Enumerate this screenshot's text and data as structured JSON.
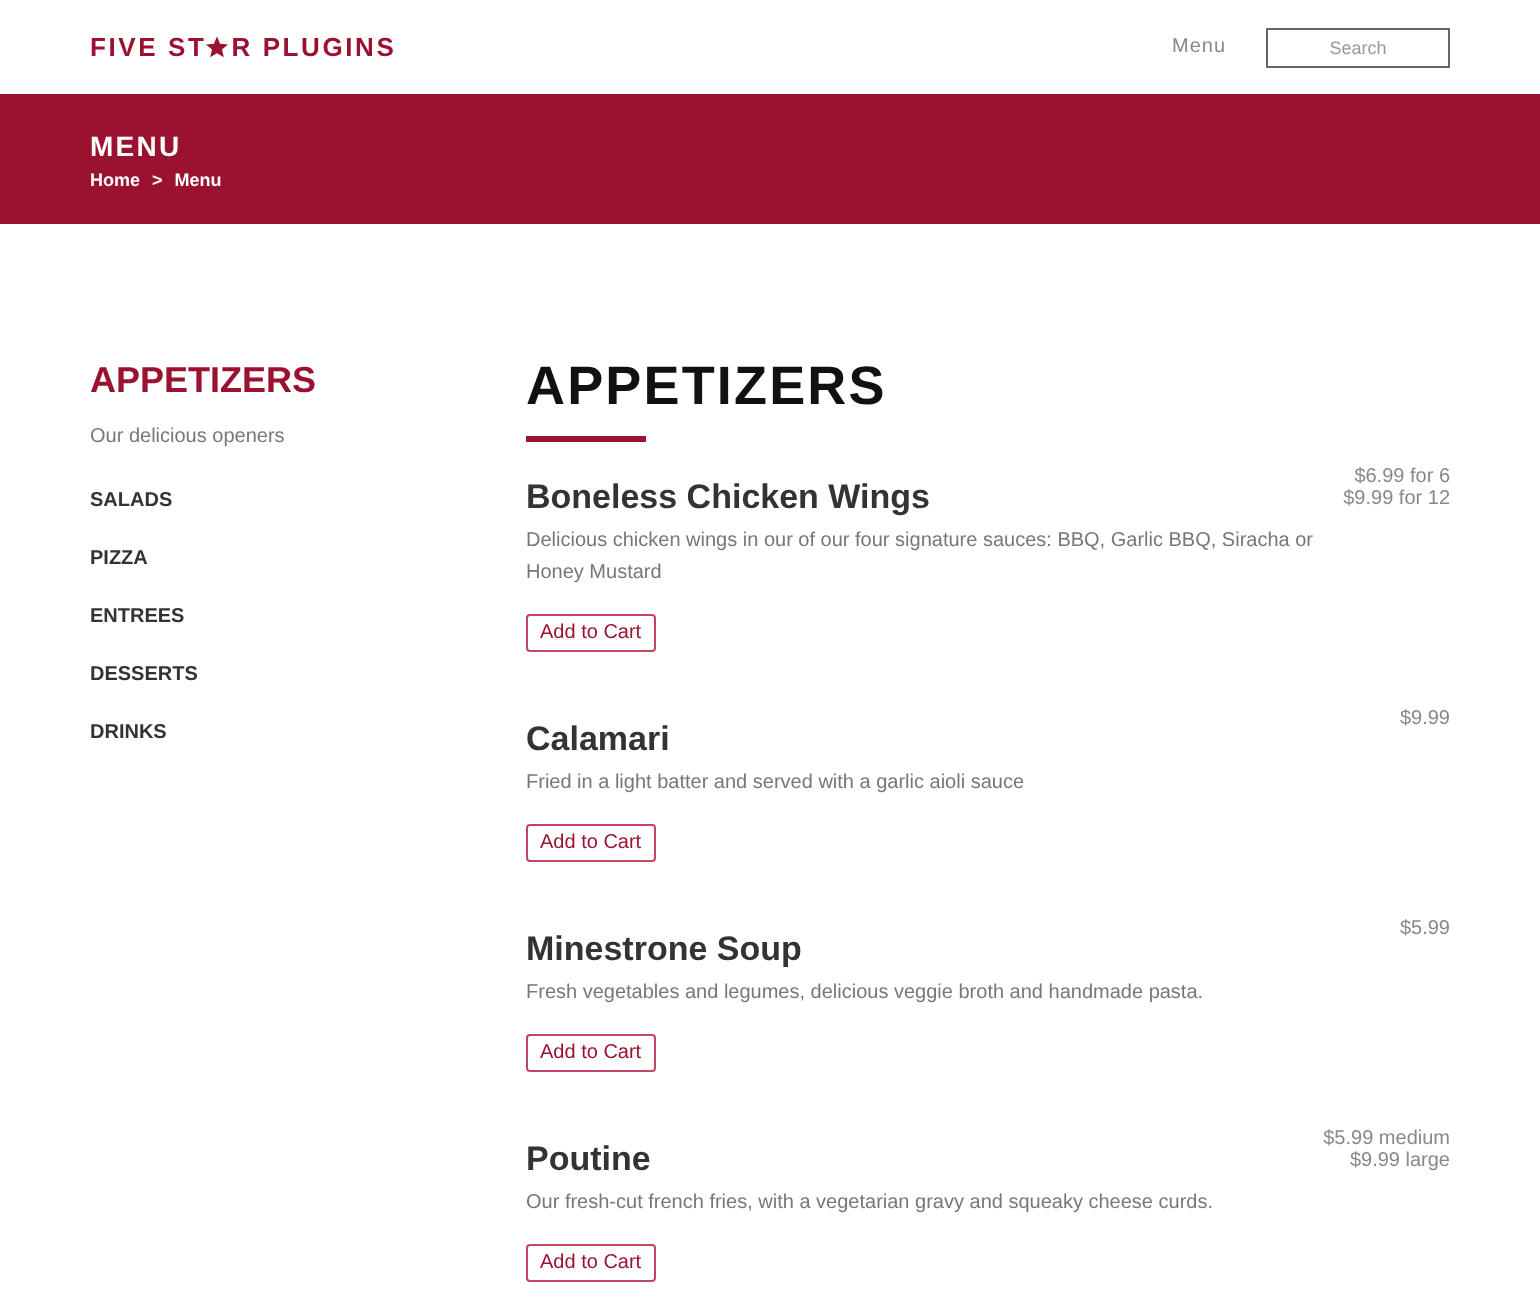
{
  "header": {
    "logo": {
      "before": "FIVE ST",
      "after": "R PLUGINS"
    },
    "nav": [
      {
        "label": "Menu"
      }
    ],
    "search": {
      "placeholder": "Search"
    }
  },
  "banner": {
    "title": "MENU",
    "breadcrumb": {
      "items": [
        {
          "label": "Home"
        },
        {
          "label": "Menu"
        }
      ],
      "separator": ">"
    }
  },
  "sidebar": {
    "title": "APPETIZERS",
    "subtitle": "Our delicious openers",
    "items": [
      {
        "label": "SALADS"
      },
      {
        "label": "PIZZA"
      },
      {
        "label": "ENTREES"
      },
      {
        "label": "DESSERTS"
      },
      {
        "label": "DRINKS"
      }
    ]
  },
  "section": {
    "title": "APPETIZERS",
    "items": [
      {
        "name": "Boneless Chicken Wings",
        "description": "Delicious chicken wings in our of our four signature sauces: BBQ, Garlic BBQ, Siracha or Honey Mustard",
        "prices": [
          "$6.99 for 6",
          "$9.99 for 12"
        ],
        "button": "Add to Cart"
      },
      {
        "name": "Calamari",
        "description": "Fried in a light batter and served with a garlic aioli sauce",
        "prices": [
          "$9.99"
        ],
        "button": "Add to Cart"
      },
      {
        "name": "Minestrone Soup",
        "description": "Fresh vegetables and legumes, delicious veggie broth and handmade pasta.",
        "prices": [
          "$5.99"
        ],
        "button": "Add to Cart"
      },
      {
        "name": "Poutine",
        "description": "Our fresh-cut french fries, with a vegetarian gravy and squeaky cheese curds.",
        "prices": [
          "$5.99 medium",
          "$9.99 large"
        ],
        "button": "Add to Cart"
      }
    ]
  }
}
